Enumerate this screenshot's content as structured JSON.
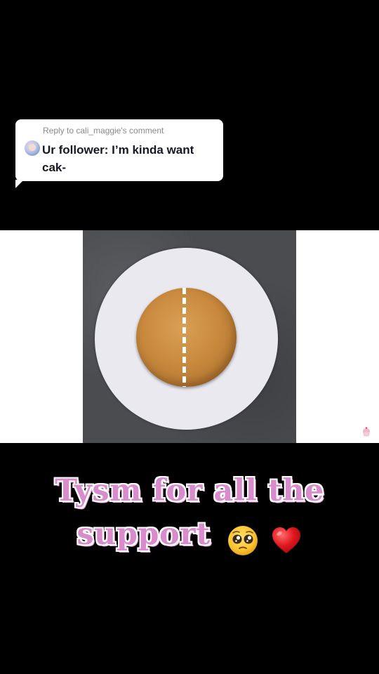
{
  "reply": {
    "header": "Reply to cali_maggie's comment",
    "comment": "Ur follower: I’m kinda want cak-"
  },
  "caption": {
    "line1": "Tysm for all the",
    "line2": "support",
    "emojis": [
      "pleading-face-icon",
      "red-heart-icon"
    ]
  },
  "colors": {
    "background": "#000000",
    "caption_text": "#d98ccc",
    "caption_outline": "#ffffff"
  }
}
